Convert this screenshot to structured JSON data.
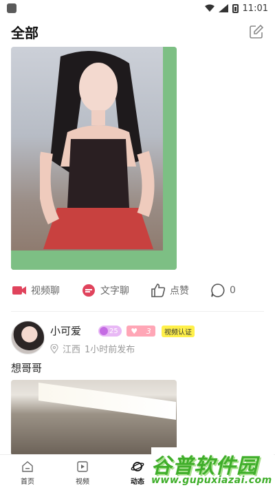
{
  "status_bar": {
    "time": "11:01"
  },
  "header": {
    "title": "全部"
  },
  "post1": {
    "actions": {
      "video_chat": "视频聊",
      "text_chat": "文字聊",
      "like": "点赞",
      "comments": "0"
    }
  },
  "post2": {
    "username": "小可爱",
    "level": "25",
    "heart_level": "3",
    "video_verified": "视频认证",
    "location": "江西",
    "time": "1小时前发布",
    "text": "想哥哥"
  },
  "tabbar": {
    "items": [
      {
        "label": "首页"
      },
      {
        "label": "视频"
      },
      {
        "label": "动态"
      }
    ]
  },
  "watermark": {
    "title": "谷普软件园",
    "url": "www.gupuxiazai.com"
  },
  "colors": {
    "accent_green": "#7dbf84",
    "video_icon": "#e0435c",
    "text_chat_icon": "#e0435c",
    "level_badge": "#e8b8f5",
    "heart_badge": "#ffa6b6",
    "video_badge": "#fff04a",
    "watermark_green": "#3fae2a"
  }
}
